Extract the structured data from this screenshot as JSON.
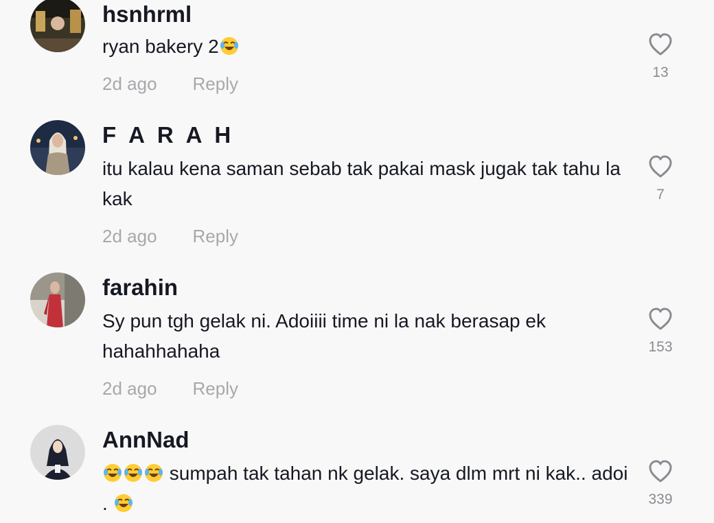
{
  "comments": [
    {
      "username": "hsnhrml",
      "text_before": "ryan bakery 2",
      "text_after": "",
      "emoji_count": 1,
      "time": "2d ago",
      "reply_label": "Reply",
      "likes": "13",
      "avatar_colors": [
        "#3a3424",
        "#c9a45a",
        "#7a5a3a"
      ]
    },
    {
      "username": "F A R A H",
      "text_before": "itu kalau kena saman sebab tak pakai mask jugak tak tahu la kak",
      "text_after": "",
      "emoji_count": 0,
      "time": "2d ago",
      "reply_label": "Reply",
      "likes": "7",
      "avatar_colors": [
        "#1d2b45",
        "#e8e2d6",
        "#a89a82"
      ]
    },
    {
      "username": "farahin",
      "text_before": "Sy pun tgh gelak ni. Adoiiii time ni la nak berasap ek hahahhahaha",
      "text_after": "",
      "emoji_count": 0,
      "time": "2d ago",
      "reply_label": "Reply",
      "likes": "153",
      "avatar_colors": [
        "#7d7a72",
        "#c2303a",
        "#d8c8b8"
      ]
    },
    {
      "username": "AnnNad",
      "text_before": "",
      "text_middle": " sumpah tak tahan nk gelak. saya dlm mrt ni kak.. adoi . ",
      "emoji_count": 3,
      "time": "2d ago",
      "reply_label": "Reply",
      "likes": "339",
      "avatar_colors": [
        "#dcdcdc",
        "#1c2030",
        "#f0d8c4"
      ]
    }
  ],
  "icons": {
    "like": "heart-outline-icon",
    "emoji": "face-with-tears-of-joy-icon"
  }
}
